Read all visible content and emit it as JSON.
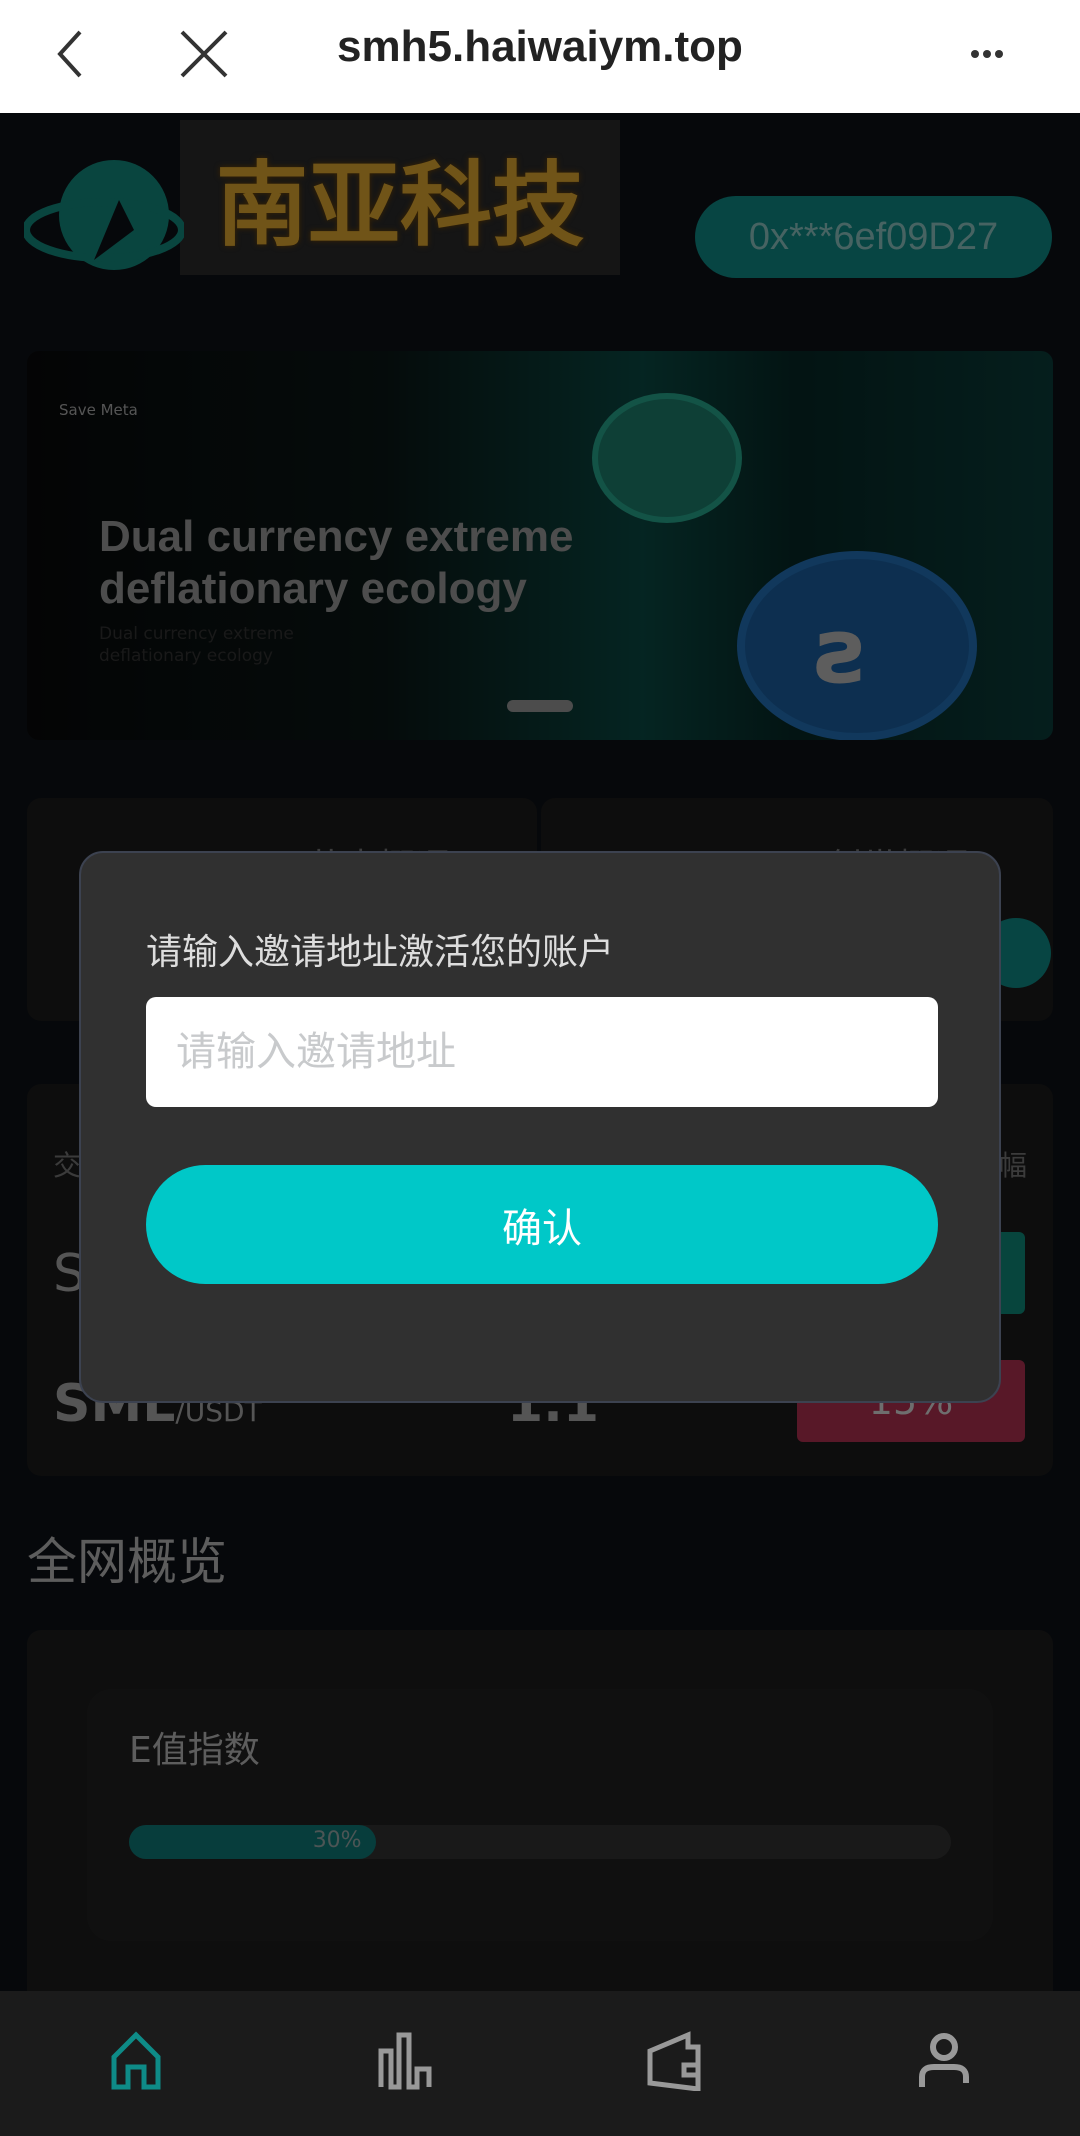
{
  "browser": {
    "title": "smh5.haiwaiym.top",
    "back_icon": "chevron-left-icon",
    "close_icon": "close-icon",
    "menu_icon": "more-horizontal-icon"
  },
  "header": {
    "brand": "南亚科技",
    "wallet_address": "0x***6ef09D27"
  },
  "banner": {
    "brand": "Save Meta",
    "headline_1": "Dual currency extreme",
    "headline_2": "deflationary ecology",
    "sub_1": "Dual currency extreme",
    "sub_2": "deflationary ecology"
  },
  "overview_cards": [
    {
      "label": "节点概况"
    },
    {
      "label": "创世概况"
    }
  ],
  "prices": {
    "col_pair": "交",
    "col_change": "幅",
    "rows": [
      {
        "pair": "S",
        "quote": "",
        "price": "",
        "change": "",
        "color": "#0e8b7a"
      },
      {
        "pair": "SML",
        "quote": "/USDT",
        "price": "1.1",
        "change": "15%",
        "color": "#b03050"
      }
    ]
  },
  "network": {
    "title": "全网概览",
    "e_index_label": "E值指数",
    "e_index_percent": 30,
    "e_index_text": "30%"
  },
  "modal": {
    "title": "请输入邀请地址激活您的账户",
    "input_placeholder": "请输入邀请地址",
    "input_value": "",
    "confirm_label": "确认"
  },
  "nav": [
    {
      "icon": "home-icon",
      "active": true
    },
    {
      "icon": "chart-icon"
    },
    {
      "icon": "wallet-icon"
    },
    {
      "icon": "user-icon"
    }
  ],
  "colors": {
    "accent": "#00c8c8",
    "teal": "#0e8b87",
    "danger": "#b03050"
  }
}
